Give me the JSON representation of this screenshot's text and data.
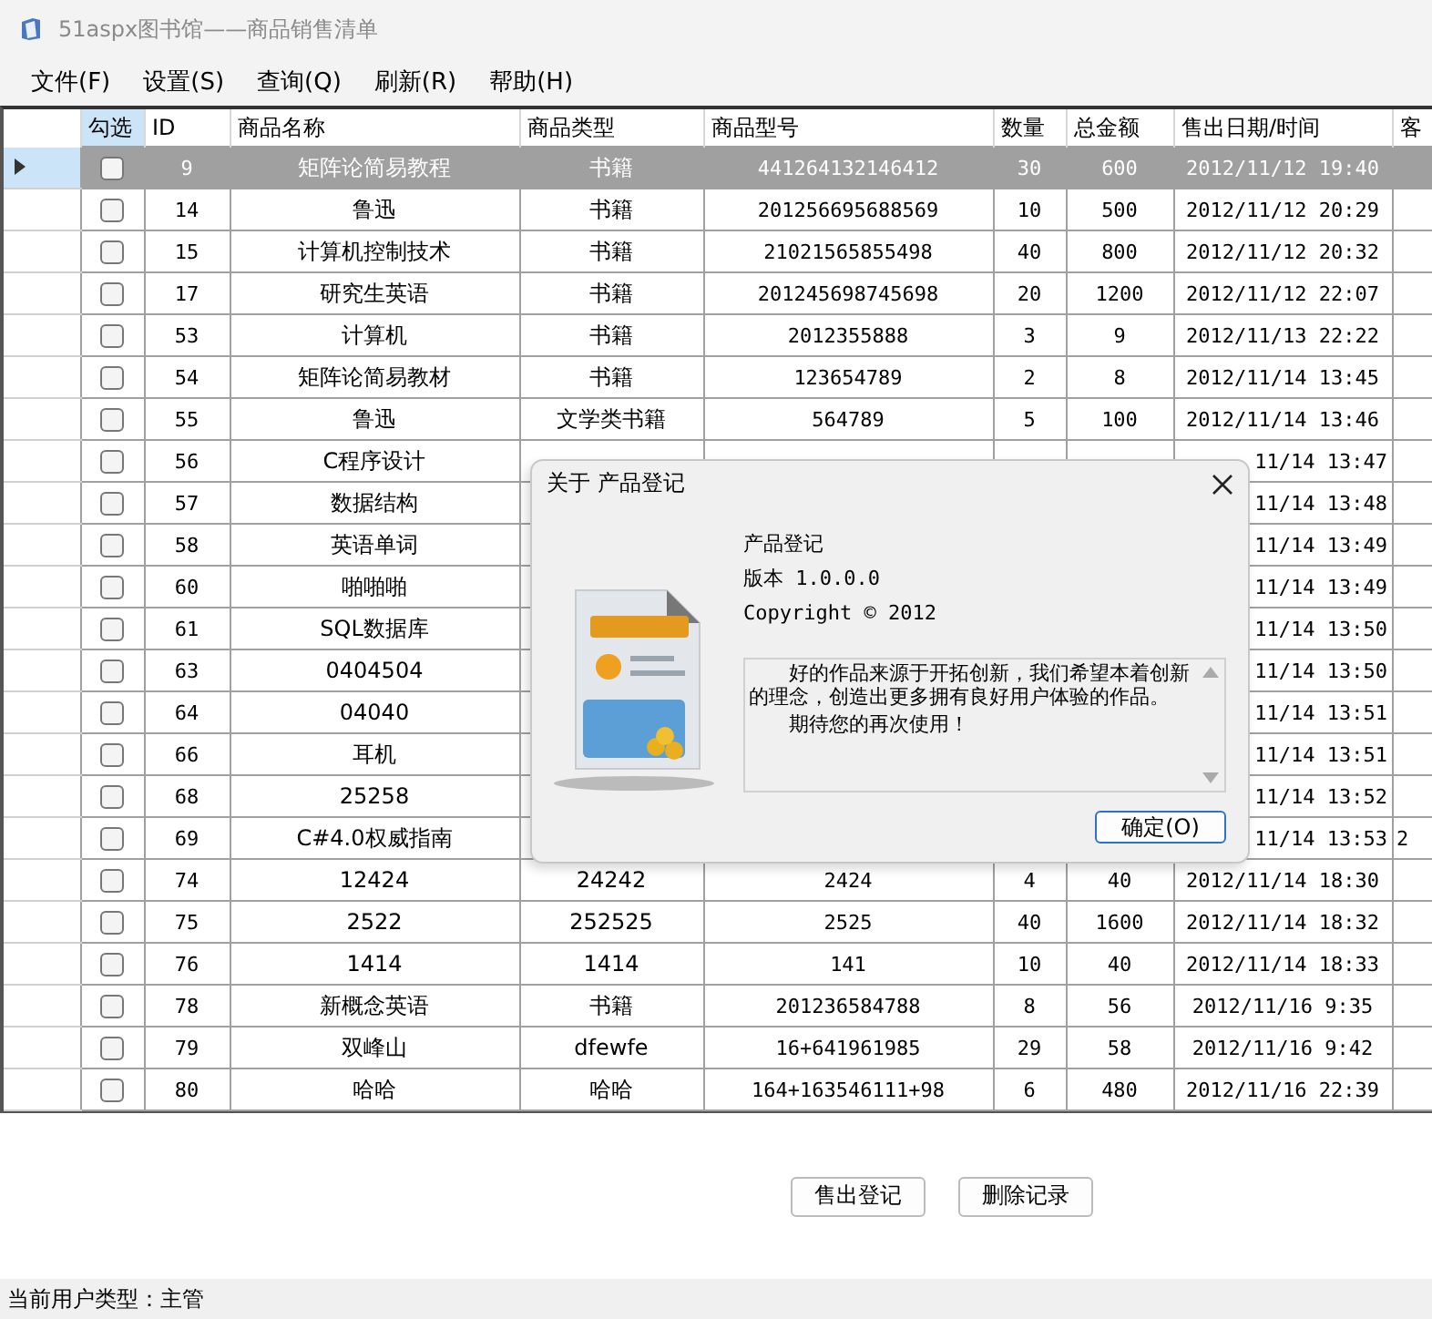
{
  "window": {
    "title": "51aspx图书馆——商品销售清单"
  },
  "menu": [
    "文件(F)",
    "设置(S)",
    "查询(Q)",
    "刷新(R)",
    "帮助(H)"
  ],
  "table": {
    "columns": [
      "勾选",
      "ID",
      "商品名称",
      "商品类型",
      "商品型号",
      "数量",
      "总金额",
      "售出日期/时间",
      "客"
    ],
    "rows": [
      {
        "selected": true,
        "checked": false,
        "id": "9",
        "name": "矩阵论简易教程",
        "type": "书籍",
        "model": "441264132146412",
        "qty": "30",
        "total": "600",
        "sold_at": "2012/11/12 19:40"
      },
      {
        "selected": false,
        "checked": false,
        "id": "14",
        "name": "鲁迅",
        "type": "书籍",
        "model": "201256695688569",
        "qty": "10",
        "total": "500",
        "sold_at": "2012/11/12 20:29"
      },
      {
        "selected": false,
        "checked": false,
        "id": "15",
        "name": "计算机控制技术",
        "type": "书籍",
        "model": "21021565855498",
        "qty": "40",
        "total": "800",
        "sold_at": "2012/11/12 20:32"
      },
      {
        "selected": false,
        "checked": false,
        "id": "17",
        "name": "研究生英语",
        "type": "书籍",
        "model": "201245698745698",
        "qty": "20",
        "total": "1200",
        "sold_at": "2012/11/12 22:07"
      },
      {
        "selected": false,
        "checked": false,
        "id": "53",
        "name": "计算机",
        "type": "书籍",
        "model": "2012355888",
        "qty": "3",
        "total": "9",
        "sold_at": "2012/11/13 22:22"
      },
      {
        "selected": false,
        "checked": false,
        "id": "54",
        "name": "矩阵论简易教材",
        "type": "书籍",
        "model": "123654789",
        "qty": "2",
        "total": "8",
        "sold_at": "2012/11/14 13:45"
      },
      {
        "selected": false,
        "checked": false,
        "id": "55",
        "name": "鲁迅",
        "type": "文学类书籍",
        "model": "564789",
        "qty": "5",
        "total": "100",
        "sold_at": "2012/11/14 13:46"
      },
      {
        "selected": false,
        "checked": false,
        "id": "56",
        "name": "C程序设计",
        "sold_at": "11/14 13:47"
      },
      {
        "selected": false,
        "checked": false,
        "id": "57",
        "name": "数据结构",
        "sold_at": "11/14 13:48"
      },
      {
        "selected": false,
        "checked": false,
        "id": "58",
        "name": "英语单词",
        "sold_at": "11/14 13:49"
      },
      {
        "selected": false,
        "checked": false,
        "id": "60",
        "name": "啪啪啪",
        "sold_at": "11/14 13:49"
      },
      {
        "selected": false,
        "checked": false,
        "id": "61",
        "name": "SQL数据库",
        "sold_at": "11/14 13:50"
      },
      {
        "selected": false,
        "checked": false,
        "id": "63",
        "name": "0404504",
        "sold_at": "11/14 13:50"
      },
      {
        "selected": false,
        "checked": false,
        "id": "64",
        "name": "04040",
        "sold_at": "11/14 13:51"
      },
      {
        "selected": false,
        "checked": false,
        "id": "66",
        "name": "耳机",
        "sold_at": "11/14 13:51"
      },
      {
        "selected": false,
        "checked": false,
        "id": "68",
        "name": "25258",
        "sold_at": "11/14 13:52"
      },
      {
        "selected": false,
        "checked": false,
        "id": "69",
        "name": "C#4.0权威指南",
        "sold_at": "11/14 13:53",
        "customer": "2"
      },
      {
        "selected": false,
        "checked": false,
        "id": "74",
        "name": "12424",
        "type": "24242",
        "model": "2424",
        "qty": "4",
        "total": "40",
        "sold_at": "2012/11/14 18:30"
      },
      {
        "selected": false,
        "checked": false,
        "id": "75",
        "name": "2522",
        "type": "252525",
        "model": "2525",
        "qty": "40",
        "total": "1600",
        "sold_at": "2012/11/14 18:32"
      },
      {
        "selected": false,
        "checked": false,
        "id": "76",
        "name": "1414",
        "type": "1414",
        "model": "141",
        "qty": "10",
        "total": "40",
        "sold_at": "2012/11/14 18:33"
      },
      {
        "selected": false,
        "checked": false,
        "id": "78",
        "name": "新概念英语",
        "type": "书籍",
        "model": "201236584788",
        "qty": "8",
        "total": "56",
        "sold_at": "2012/11/16 9:35"
      },
      {
        "selected": false,
        "checked": false,
        "id": "79",
        "name": "双峰山",
        "type": "dfewfe",
        "model": "16+641961985",
        "qty": "29",
        "total": "58",
        "sold_at": "2012/11/16 9:42"
      },
      {
        "selected": false,
        "checked": false,
        "id": "80",
        "name": "哈哈",
        "type": "哈哈",
        "model": "164+163546111+98",
        "qty": "6",
        "total": "480",
        "sold_at": "2012/11/16 22:39"
      }
    ]
  },
  "buttons": [
    "售出登记",
    "删除记录"
  ],
  "status_bar": "当前用户类型：主管",
  "dialog": {
    "title": "关于 产品登记",
    "product": "产品登记",
    "version": "版本 1.0.0.0",
    "copyright": "Copyright ©  2012",
    "description": [
      "　　好的作品来源于开拓创新，我们希望本着创新的理念，创造出更多拥有良好用户体验的作品。",
      "　　期待您的再次使用！"
    ],
    "ok_button": "确定(O)"
  }
}
